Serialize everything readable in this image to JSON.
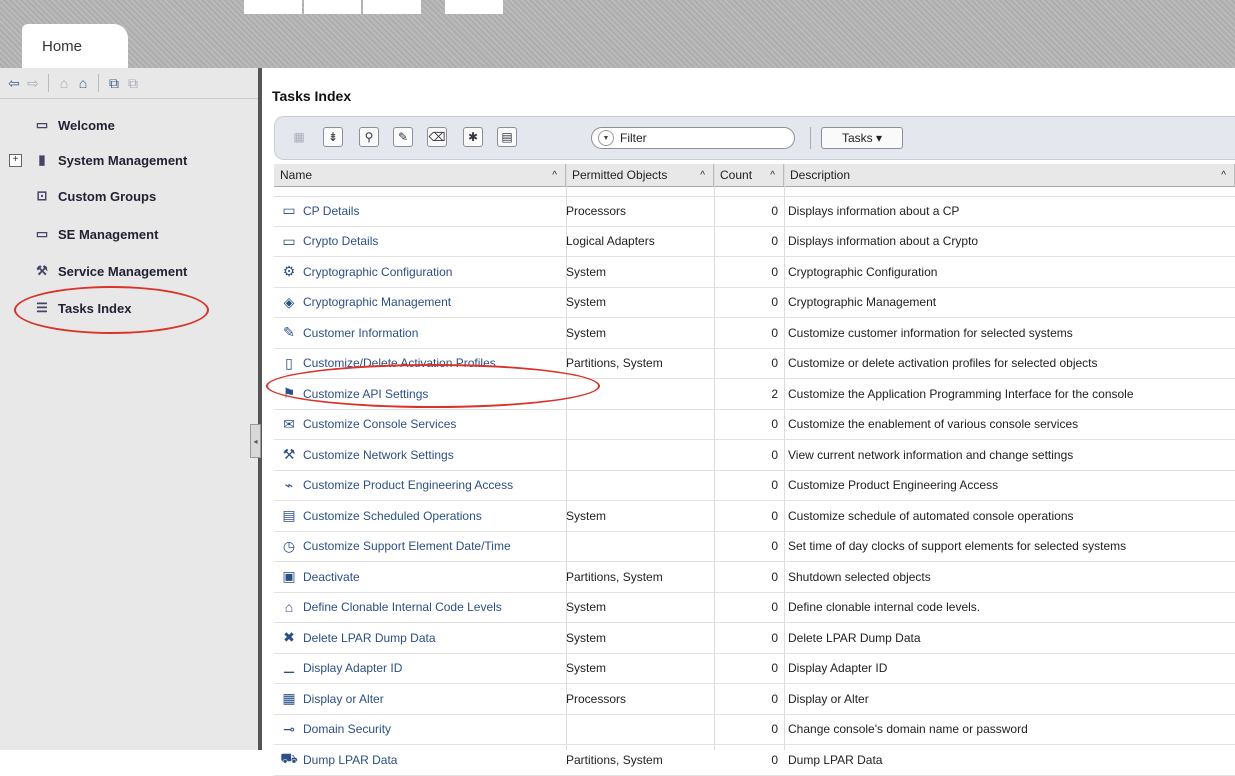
{
  "top_tab": {
    "label": "Home"
  },
  "left_nav": {
    "items": [
      {
        "label": "Welcome",
        "icon": "window-icon"
      },
      {
        "label": "System Management",
        "icon": "server-icon",
        "expander": "+"
      },
      {
        "label": "Custom Groups",
        "icon": "groups-icon"
      },
      {
        "label": "SE Management",
        "icon": "laptop-icon"
      },
      {
        "label": "Service Management",
        "icon": "tools-icon"
      },
      {
        "label": "Tasks Index",
        "icon": "list-icon",
        "selected": true
      }
    ]
  },
  "main": {
    "title": "Tasks Index",
    "filter_placeholder": "Filter",
    "tasks_button": "Tasks ▾",
    "columns": [
      {
        "label": "Name",
        "sort": "^"
      },
      {
        "label": "Permitted Objects",
        "sort": "^"
      },
      {
        "label": "Count",
        "sort": "^"
      },
      {
        "label": "Description",
        "sort": "^"
      }
    ],
    "rows": [
      {
        "name": "CP Details",
        "icon": "monitor-icon",
        "permitted": "Processors",
        "count": "0",
        "description": "Displays information about a CP"
      },
      {
        "name": "Crypto Details",
        "icon": "monitor-icon",
        "permitted": "Logical Adapters",
        "count": "0",
        "description": "Displays information about a Crypto"
      },
      {
        "name": "Cryptographic Configuration",
        "icon": "crypto-config-icon",
        "permitted": "System",
        "count": "0",
        "description": "Cryptographic Configuration"
      },
      {
        "name": "Cryptographic Management",
        "icon": "crypto-mgmt-icon",
        "permitted": "System",
        "count": "0",
        "description": "Cryptographic Management"
      },
      {
        "name": "Customer Information",
        "icon": "document-edit-icon",
        "permitted": "System",
        "count": "0",
        "description": "Customize customer information for selected systems"
      },
      {
        "name": "Customize/Delete Activation Profiles",
        "icon": "profile-icon",
        "permitted": "Partitions, System",
        "count": "0",
        "description": "Customize or delete activation profiles for selected objects"
      },
      {
        "name": "Customize API Settings",
        "icon": "api-icon",
        "permitted": "",
        "count": "2",
        "description": "Customize the Application Programming Interface for the console"
      },
      {
        "name": "Customize Console Services",
        "icon": "console-services-icon",
        "permitted": "",
        "count": "0",
        "description": "Customize the enablement of various console services"
      },
      {
        "name": "Customize Network Settings",
        "icon": "network-icon",
        "permitted": "",
        "count": "0",
        "description": "View current network information and change settings"
      },
      {
        "name": "Customize Product Engineering Access",
        "icon": "engineering-icon",
        "permitted": "",
        "count": "0",
        "description": "Customize Product Engineering Access"
      },
      {
        "name": "Customize Scheduled Operations",
        "icon": "schedule-icon",
        "permitted": "System",
        "count": "0",
        "description": "Customize schedule of automated console operations"
      },
      {
        "name": "Customize Support Element Date/Time",
        "icon": "clock-icon",
        "permitted": "",
        "count": "0",
        "description": "Set time of day clocks of support elements for selected systems"
      },
      {
        "name": "Deactivate",
        "icon": "deactivate-icon",
        "permitted": "Partitions, System",
        "count": "0",
        "description": "Shutdown selected objects"
      },
      {
        "name": "Define Clonable Internal Code Levels",
        "icon": "code-levels-icon",
        "permitted": "System",
        "count": "0",
        "description": "Define clonable internal code levels."
      },
      {
        "name": "Delete LPAR Dump Data",
        "icon": "delete-dump-icon",
        "permitted": "System",
        "count": "0",
        "description": "Delete LPAR Dump Data"
      },
      {
        "name": "Display Adapter ID",
        "icon": "adapter-icon",
        "permitted": "System",
        "count": "0",
        "description": "Display Adapter ID"
      },
      {
        "name": "Display or Alter",
        "icon": "display-alter-icon",
        "permitted": "Processors",
        "count": "0",
        "description": "Display or Alter"
      },
      {
        "name": "Domain Security",
        "icon": "key-icon",
        "permitted": "",
        "count": "0",
        "description": "Change console's domain name or password"
      },
      {
        "name": "Dump LPAR Data",
        "icon": "dump-icon",
        "permitted": "Partitions, System",
        "count": "0",
        "description": "Dump LPAR Data"
      }
    ]
  },
  "colors": {
    "link": "#2c4f86",
    "highlight_oval": "#d9332a"
  }
}
